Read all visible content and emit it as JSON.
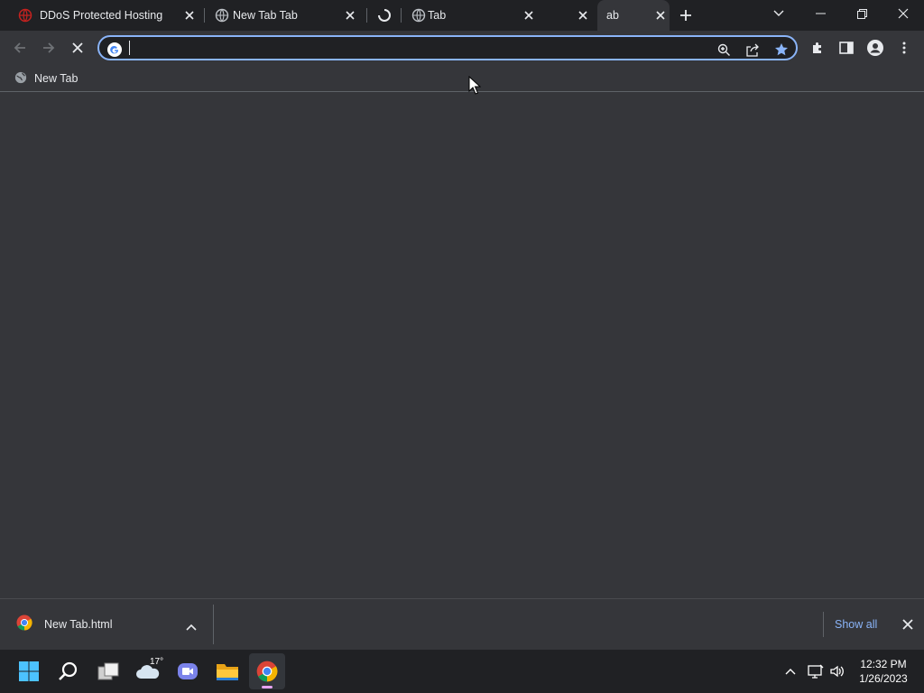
{
  "tabs": [
    {
      "title": "DDoS Protected Hosting S...",
      "favicon": "red-globe-icon"
    },
    {
      "title": "New Tab Tab",
      "favicon": "globe-icon"
    },
    {
      "title": "",
      "favicon": "loading-spinner-icon"
    },
    {
      "title": "Tab",
      "favicon": "globe-icon"
    },
    {
      "title": "ab",
      "favicon": "globe-icon",
      "active": true
    }
  ],
  "omnibox": {
    "value": "",
    "placeholder": ""
  },
  "bookmarks": [
    {
      "label": "New Tab"
    }
  ],
  "downloads": {
    "items": [
      {
        "filename": "New Tab.html"
      }
    ],
    "show_all_label": "Show all"
  },
  "taskbar": {
    "weather_temp": "17°",
    "time": "12:32 PM",
    "date": "1/26/2023"
  },
  "colors": {
    "accent": "#8ab4f8",
    "frame": "#202124",
    "toolbar": "#35363a"
  }
}
